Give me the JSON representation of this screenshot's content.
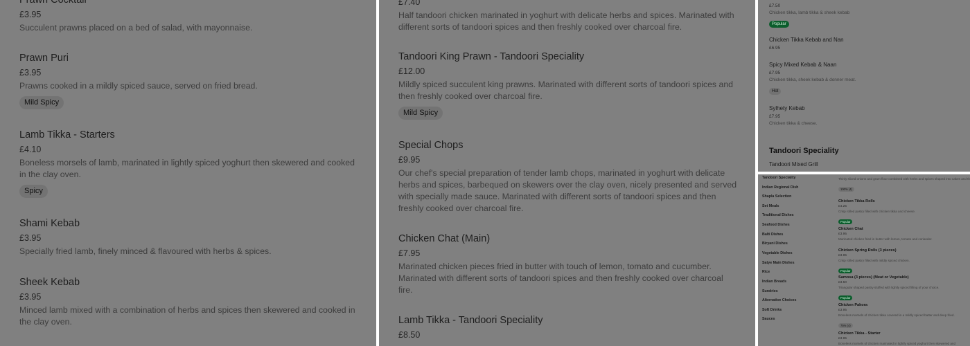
{
  "left": {
    "items": [
      {
        "name": "Prawn Cocktail",
        "price": "£3.95",
        "desc": "Succulent prawns placed on a bed of salad, with mayonnaise."
      },
      {
        "name": "Prawn Puri",
        "price": "£3.95",
        "desc": "Prawns cooked in a mildly spiced sauce, served on fried bread.",
        "tag": "Mild Spicy"
      },
      {
        "name": "Lamb Tikka - Starters",
        "price": "£4.10",
        "desc": "Boneless morsels of lamb, marinated in lightly spiced yoghurt then skewered and cooked in the clay oven.",
        "tag": "Spicy"
      },
      {
        "name": "Shami Kebab",
        "price": "£3.95",
        "desc": "Specially fried lamb, finely minced & flavoured with herbs & spices."
      },
      {
        "name": "Sheek Kebab",
        "price": "£3.95",
        "desc": "Minced lamb mixed with a combination of herbs and spices then skewered and cooked in the clay oven."
      }
    ]
  },
  "middle": {
    "items": [
      {
        "price": "£7.40",
        "desc": "Half tandoori chicken marinated in yoghurt with delicate herbs and spices. Marinated with different sorts of tandoori spices and then freshly cooked over charcoal fire."
      },
      {
        "name": "Tandoori King Prawn - Tandoori Speciality",
        "price": "£12.00",
        "desc": "Mildly spiced succulent king prawns. Marinated with different sorts of tandoori spices and then freshly cooked over charcoal fire.",
        "tag": "Mild Spicy"
      },
      {
        "name": "Special Chops",
        "price": "£9.95",
        "desc": "Our chef's special preparation of tender lamb chops, marinated in yoghurt with delicate herbs and spices, barbequed on skewers over the clay oven, nicely presented and served with specially made sauce. Marinated with different sorts of tandoori spices and then freshly cooked over charcoal fire."
      },
      {
        "name": "Chicken Chat (Main)",
        "price": "£7.95",
        "desc": "Marinated chicken pieces fried in butter with touch of lemon, tomato and cucumber. Marinated with different sorts of tandoori spices and then freshly cooked over charcoal fire."
      },
      {
        "name": "Lamb Tikka - Tandoori Speciality",
        "price": "£8.50"
      }
    ]
  },
  "top_right": {
    "items": [
      {
        "price": "£7.50",
        "desc": "Chicken tikka, lamb tikka & sheek kebab",
        "tag": "Popular",
        "tag_style": "green"
      },
      {
        "name": "Chicken Tikka Kebab and Nan",
        "price": "£6.95"
      },
      {
        "name": "Spicy Mixed Kebab & Naan",
        "price": "£7.95",
        "desc": "Chicken tikka, sheek kebab & donner meat.",
        "tag": "Hot",
        "tag_style": "grey"
      },
      {
        "name": "Sylhety Kebab",
        "price": "£7.95",
        "desc": "Chicken tikka & cheese."
      }
    ],
    "heading": "Tandoori Speciality",
    "next_item": "Tandoori Mixed Grill"
  },
  "bottom_right": {
    "nav": [
      "Tandoori Speciality",
      "Indian Regional Dish",
      "Shapla Selection",
      "Set Meals",
      "Traditional Dishes",
      "Seafood Dishes",
      "Balti Dishes",
      "Biryani Dishes",
      "Vegetable Dishes",
      "Satye Main Dishes",
      "Rice",
      "Indian Breads",
      "Sundries",
      "Alternative Choices",
      "Soft Drinks",
      "Sauces"
    ],
    "items": [
      {
        "desc": "Thinly sliced onions and gram flour combined with herbs and spices shaped into cakes and then deep fried.",
        "tag": "100% (4)",
        "tag_style": "grey"
      },
      {
        "name": "Chicken Tikka Rolls",
        "price": "£4.25",
        "desc": "Crisp rolled pastry filled with chicken tikka and cheese.",
        "tag": "Popular",
        "tag_style": "green"
      },
      {
        "name": "Chicken Chat",
        "price": "£3.95",
        "desc": "Marinated chicken fried in butter with lemon, tomato and coriander."
      },
      {
        "name": "Chicken Spring Rolls (3 pieces)",
        "price": "£3.95",
        "desc": "Crisp rolled pastry filled with mildly spiced chicken.",
        "tag": "Popular",
        "tag_style": "green"
      },
      {
        "name": "Samosa (3 pieces) (Meat or Vegetable)",
        "price": "£3.50",
        "desc": "Triangular shaped pastry stuffed with lightly spiced filling of your choice.",
        "tag": "Popular",
        "tag_style": "green"
      },
      {
        "name": "Chicken Pakora",
        "price": "£3.95",
        "desc": "Boneless morsels of chicken tikka covered in a mildly spiced batter and deep fried.",
        "tag": "75% (4)",
        "tag_style": "grey"
      },
      {
        "name": "Chicken Tikka - Starter",
        "price": "£3.95",
        "desc": "Boneless morsels of chicken marinated in lightly spiced yoghurt then skewered and"
      }
    ]
  }
}
